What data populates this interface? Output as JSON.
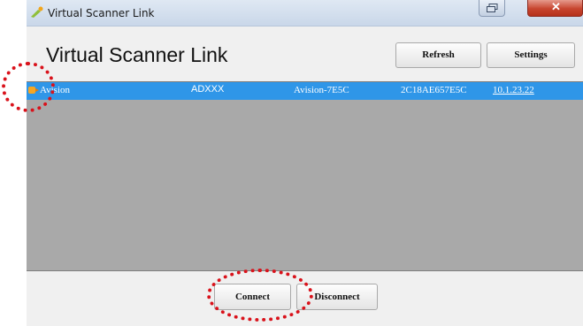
{
  "window": {
    "title": "Virtual Scanner Link",
    "heading": "Virtual Scanner Link"
  },
  "toolbar": {
    "refresh_label": "Refresh",
    "settings_label": "Settings"
  },
  "device_list": {
    "rows": [
      {
        "name": "Avision",
        "model": "ADXXX",
        "device_id": "Avision-7E5C",
        "serial": "2C18AE657E5C",
        "ip": "10.1.23.22",
        "selected": true
      }
    ]
  },
  "footer": {
    "connect_label": "Connect",
    "disconnect_label": "Disconnect"
  },
  "colors": {
    "selection": "#2f96e8",
    "list_background": "#a9a9a9",
    "annotation": "#d9121b"
  },
  "icons": [
    "scanner-app-icon",
    "restore-icon",
    "close-icon",
    "device-icon"
  ]
}
